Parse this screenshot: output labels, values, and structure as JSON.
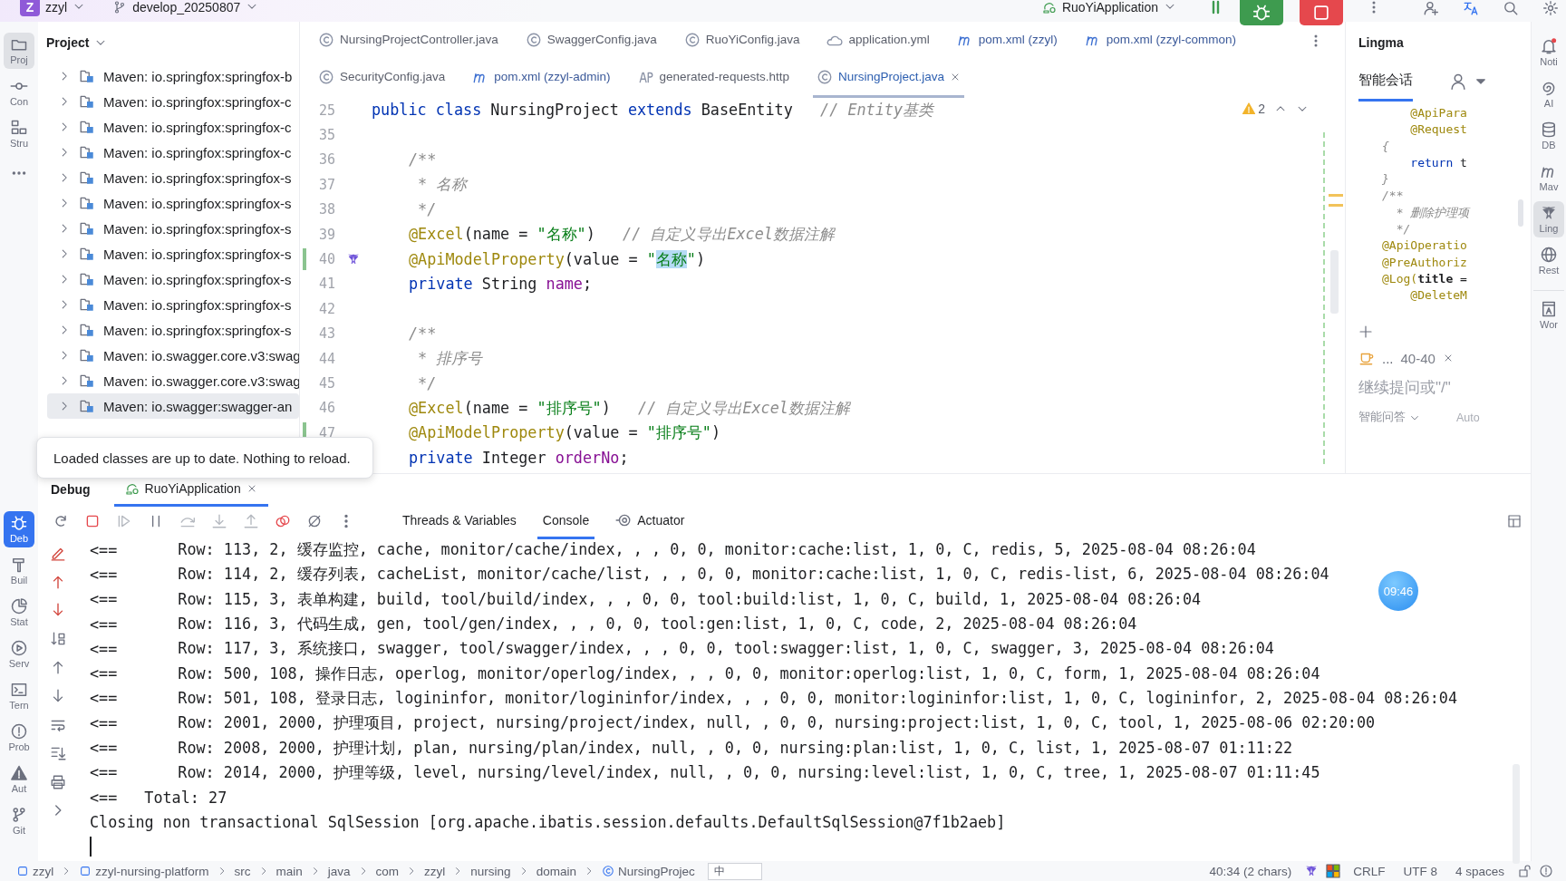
{
  "top_bar": {
    "project_badge": "Z",
    "project": "zzyl",
    "branch": "develop_20250807",
    "run_config": "RuoYiApplication"
  },
  "left_toolbar": {
    "top": [
      {
        "label": "Proj",
        "selected": true
      },
      {
        "label": "Con",
        "selected": false
      },
      {
        "label": "Stru",
        "selected": false
      }
    ],
    "bottom": [
      {
        "label": "Deb",
        "selected": true
      },
      {
        "label": "Buil",
        "selected": false
      },
      {
        "label": "Stat",
        "selected": false
      },
      {
        "label": "Serv",
        "selected": false
      },
      {
        "label": "Tern",
        "selected": false
      },
      {
        "label": "Prob",
        "selected": false
      },
      {
        "label": "Aut",
        "selected": false
      },
      {
        "label": "Git",
        "selected": false
      }
    ]
  },
  "project_panel": {
    "title": "Project",
    "items": [
      {
        "label": "Maven: io.springfox:springfox-b",
        "expanded": false,
        "selected": false
      },
      {
        "label": "Maven: io.springfox:springfox-c",
        "expanded": false,
        "selected": false
      },
      {
        "label": "Maven: io.springfox:springfox-c",
        "expanded": false,
        "selected": false
      },
      {
        "label": "Maven: io.springfox:springfox-c",
        "expanded": false,
        "selected": false
      },
      {
        "label": "Maven: io.springfox:springfox-s",
        "expanded": false,
        "selected": false
      },
      {
        "label": "Maven: io.springfox:springfox-s",
        "expanded": false,
        "selected": false
      },
      {
        "label": "Maven: io.springfox:springfox-s",
        "expanded": false,
        "selected": false
      },
      {
        "label": "Maven: io.springfox:springfox-s",
        "expanded": false,
        "selected": false
      },
      {
        "label": "Maven: io.springfox:springfox-s",
        "expanded": false,
        "selected": false
      },
      {
        "label": "Maven: io.springfox:springfox-s",
        "expanded": false,
        "selected": false
      },
      {
        "label": "Maven: io.springfox:springfox-s",
        "expanded": false,
        "selected": false
      },
      {
        "label": "Maven: io.swagger.core.v3:swag",
        "expanded": false,
        "selected": false
      },
      {
        "label": "Maven: io.swagger.core.v3:swag",
        "expanded": false,
        "selected": false
      },
      {
        "label": "Maven: io.swagger:swagger-an",
        "expanded": false,
        "selected": true
      }
    ]
  },
  "editor": {
    "tab_rows": [
      [
        {
          "label": "NursingProjectController.java",
          "kind": "class",
          "selected": false
        },
        {
          "label": "SwaggerConfig.java",
          "kind": "class",
          "selected": false
        },
        {
          "label": "RuoYiConfig.java",
          "kind": "class",
          "selected": false
        },
        {
          "label": "application.yml",
          "kind": "yaml",
          "selected": false
        },
        {
          "label": "pom.xml (zzyl)",
          "kind": "maven",
          "selected": false
        },
        {
          "label": "pom.xml (zzyl-common)",
          "kind": "maven",
          "selected": false
        }
      ],
      [
        {
          "label": "SecurityConfig.java",
          "kind": "class",
          "selected": false
        },
        {
          "label": "pom.xml (zzyl-admin)",
          "kind": "maven",
          "selected": false
        },
        {
          "label": "generated-requests.http",
          "kind": "http",
          "selected": false
        },
        {
          "label": "NursingProject.java",
          "kind": "class",
          "selected": true
        }
      ]
    ],
    "warnings": "2",
    "lines": [
      {
        "number": "25",
        "kind": "declaration",
        "changed": false,
        "segments": [
          {
            "kind": "keyword",
            "text": "public class "
          },
          {
            "kind": "plain",
            "text": "NursingProject "
          },
          {
            "kind": "keyword",
            "text": "extends "
          },
          {
            "kind": "plain",
            "text": "BaseEntity   "
          },
          {
            "kind": "comment",
            "text": "// Entity基类"
          }
        ]
      },
      {
        "number": "35",
        "changed": false
      },
      {
        "number": "36",
        "kind": "member",
        "changed": false,
        "segments": [
          {
            "kind": "doc",
            "text": "/**"
          }
        ]
      },
      {
        "number": "37",
        "kind": "member",
        "changed": false,
        "segments": [
          {
            "kind": "doc",
            "text": " * 名称"
          }
        ]
      },
      {
        "number": "38",
        "kind": "member",
        "changed": false,
        "segments": [
          {
            "kind": "doc",
            "text": " */"
          }
        ]
      },
      {
        "number": "39",
        "kind": "member",
        "changed": false,
        "segments": [
          {
            "kind": "annotation",
            "text": "@Excel"
          },
          {
            "kind": "plain",
            "text": "(name = "
          },
          {
            "kind": "string",
            "text": "\"名称\""
          },
          {
            "kind": "plain",
            "text": ")   "
          },
          {
            "kind": "comment",
            "text": "// 自定义导出Excel数据注解"
          }
        ]
      },
      {
        "number": "40",
        "kind": "member",
        "changed": true,
        "ai_marker": true,
        "segments": [
          {
            "kind": "annotation",
            "text": "@ApiModelProperty"
          },
          {
            "kind": "plain",
            "text": "(value = "
          },
          {
            "kind": "string",
            "text": "\""
          },
          {
            "kind": "match",
            "text": "名称"
          },
          {
            "kind": "string",
            "text": "\""
          },
          {
            "kind": "plain",
            "text": ")"
          }
        ]
      },
      {
        "number": "41",
        "kind": "member",
        "changed": false,
        "segments": [
          {
            "kind": "keyword",
            "text": "private "
          },
          {
            "kind": "plain",
            "text": "String "
          },
          {
            "kind": "field",
            "text": "name"
          },
          {
            "kind": "plain",
            "text": ";"
          }
        ]
      },
      {
        "number": "42",
        "changed": false
      },
      {
        "number": "43",
        "kind": "member",
        "changed": false,
        "segments": [
          {
            "kind": "doc",
            "text": "/**"
          }
        ]
      },
      {
        "number": "44",
        "kind": "member",
        "changed": false,
        "segments": [
          {
            "kind": "doc",
            "text": " * 排序号"
          }
        ]
      },
      {
        "number": "45",
        "kind": "member",
        "changed": false,
        "segments": [
          {
            "kind": "doc",
            "text": " */"
          }
        ]
      },
      {
        "number": "46",
        "kind": "member",
        "changed": false,
        "segments": [
          {
            "kind": "annotation",
            "text": "@Excel"
          },
          {
            "kind": "plain",
            "text": "(name = "
          },
          {
            "kind": "string",
            "text": "\"排序号\""
          },
          {
            "kind": "plain",
            "text": ")   "
          },
          {
            "kind": "comment",
            "text": "// 自定义导出Excel数据注解"
          }
        ]
      },
      {
        "number": "47",
        "kind": "member",
        "changed": true,
        "segments": [
          {
            "kind": "annotation",
            "text": "@ApiModelProperty"
          },
          {
            "kind": "plain",
            "text": "(value = "
          },
          {
            "kind": "string",
            "text": "\"排序号\""
          },
          {
            "kind": "plain",
            "text": ")"
          }
        ]
      },
      {
        "kind": "member",
        "segments": [
          {
            "kind": "keyword",
            "text": "private "
          },
          {
            "kind": "plain",
            "text": "Integer "
          },
          {
            "kind": "field",
            "text": "orderNo"
          },
          {
            "kind": "plain",
            "text": ";"
          }
        ]
      }
    ]
  },
  "lingma": {
    "title": "Lingma",
    "tabs": [
      {
        "label": "智能会话",
        "selected": true
      }
    ],
    "snippet": [
      [
        {
          "kind": "annotation",
          "text": "    @ApiPara"
        }
      ],
      [
        {
          "kind": "annotation",
          "text": "    @Request"
        }
      ],
      [
        {
          "kind": "doc",
          "text": "{"
        }
      ],
      [
        {
          "kind": "keyword",
          "text": "    return"
        },
        {
          "kind": "plain",
          "text": " t"
        }
      ],
      [
        {
          "kind": "doc",
          "text": "}"
        }
      ],
      [
        {
          "kind": "doc",
          "text": "/**"
        }
      ],
      [
        {
          "kind": "doc",
          "text": "  * 删除护理项"
        }
      ],
      [
        {
          "kind": "doc",
          "text": "  */"
        }
      ],
      [
        {
          "kind": "annotation",
          "text": "@ApiOperatio"
        }
      ],
      [
        {
          "kind": "annotation",
          "text": "@PreAuthoriz"
        }
      ],
      [
        {
          "kind": "annotation",
          "text": "@Log("
        },
        {
          "kind": "bold",
          "text": "title"
        },
        {
          "kind": "plain",
          "text": " ="
        }
      ],
      [
        {
          "kind": "annotation",
          "text": "    @DeleteM"
        }
      ]
    ],
    "context_chip": {
      "name": "...",
      "range": "40-40"
    },
    "placeholder": "继续提问或\"/\"",
    "mode": "智能问答",
    "model": "Auto"
  },
  "right_toolbar": [
    {
      "label": "Noti",
      "selected": false
    },
    {
      "label": "AI",
      "selected": false
    },
    {
      "label": "DB",
      "selected": false
    },
    {
      "label": "Mav",
      "selected": false
    },
    {
      "label": "Ling",
      "selected": true
    },
    {
      "label": "Rest",
      "selected": false
    },
    {
      "label": "Wor",
      "selected": false
    }
  ],
  "notification": {
    "text": "Loaded classes are up to date. Nothing to reload."
  },
  "debug": {
    "title": "Debug",
    "tabs": [
      {
        "label": "RuoYiApplication",
        "selected": true
      }
    ],
    "subtabs": [
      {
        "label": "Threads & Variables",
        "selected": false
      },
      {
        "label": "Console",
        "selected": true
      },
      {
        "label": "Actuator",
        "selected": false
      }
    ],
    "timer": "09:46",
    "lines": [
      {
        "kind": "row",
        "prefix": "<==",
        "text": "Row: 113, 2, 缓存监控, cache, monitor/cache/index, , , 0, 0, monitor:cache:list, 1, 0, C, redis, 5, 2025-08-04 08:26:04"
      },
      {
        "kind": "row",
        "prefix": "<==",
        "text": "Row: 114, 2, 缓存列表, cacheList, monitor/cache/list, , , 0, 0, monitor:cache:list, 1, 0, C, redis-list, 6, 2025-08-04 08:26:04"
      },
      {
        "kind": "row",
        "prefix": "<==",
        "text": "Row: 115, 3, 表单构建, build, tool/build/index, , , 0, 0, tool:build:list, 1, 0, C, build, 1, 2025-08-04 08:26:04"
      },
      {
        "kind": "row",
        "prefix": "<==",
        "text": "Row: 116, 3, 代码生成, gen, tool/gen/index, , , 0, 0, tool:gen:list, 1, 0, C, code, 2, 2025-08-04 08:26:04"
      },
      {
        "kind": "row",
        "prefix": "<==",
        "text": "Row: 117, 3, 系统接口, swagger, tool/swagger/index, , , 0, 0, tool:swagger:list, 1, 0, C, swagger, 3, 2025-08-04 08:26:04"
      },
      {
        "kind": "row",
        "prefix": "<==",
        "text": "Row: 500, 108, 操作日志, operlog, monitor/operlog/index, , , 0, 0, monitor:operlog:list, 1, 0, C, form, 1, 2025-08-04 08:26:04"
      },
      {
        "kind": "row",
        "prefix": "<==",
        "text": "Row: 501, 108, 登录日志, logininfor, monitor/logininfor/index, , , 0, 0, monitor:logininfor:list, 1, 0, C, logininfor, 2, 2025-08-04 08:26:04"
      },
      {
        "kind": "row",
        "prefix": "<==",
        "text": "Row: 2001, 2000, 护理项目, project, nursing/project/index, null, , 0, 0, nursing:project:list, 1, 0, C, tool, 1, 2025-08-06 02:20:00"
      },
      {
        "kind": "row",
        "prefix": "<==",
        "text": "Row: 2008, 2000, 护理计划, plan, nursing/plan/index, null, , 0, 0, nursing:plan:list, 1, 0, C, list, 1, 2025-08-07 01:11:22"
      },
      {
        "kind": "row",
        "prefix": "<==",
        "text": "Row: 2014, 2000, 护理等级, level, nursing/level/index, null, , 0, 0, nursing:level:list, 1, 0, C, tree, 1, 2025-08-07 01:11:45"
      },
      {
        "kind": "total",
        "prefix": "<==",
        "text": "Total: 27"
      },
      {
        "kind": "plain",
        "text": "Closing non transactional SqlSession [org.apache.ibatis.session.defaults.DefaultSqlSession@7f1b2aeb]"
      }
    ]
  },
  "status_bar": {
    "breadcrumbs": [
      {
        "label": "zzyl",
        "kind": "module"
      },
      {
        "label": "zzyl-nursing-platform",
        "kind": "module"
      },
      {
        "label": "src",
        "kind": "folder"
      },
      {
        "label": "main",
        "kind": "folder"
      },
      {
        "label": "java",
        "kind": "folder"
      },
      {
        "label": "com",
        "kind": "folder"
      },
      {
        "label": "zzyl",
        "kind": "folder"
      },
      {
        "label": "nursing",
        "kind": "folder"
      },
      {
        "label": "domain",
        "kind": "folder"
      },
      {
        "label": "NursingProjec",
        "kind": "class"
      }
    ],
    "ime": "中",
    "position": "40:34 (2 chars)",
    "line_ending": "CRLF",
    "encoding": "UTF 8",
    "indent": "4 spaces"
  }
}
